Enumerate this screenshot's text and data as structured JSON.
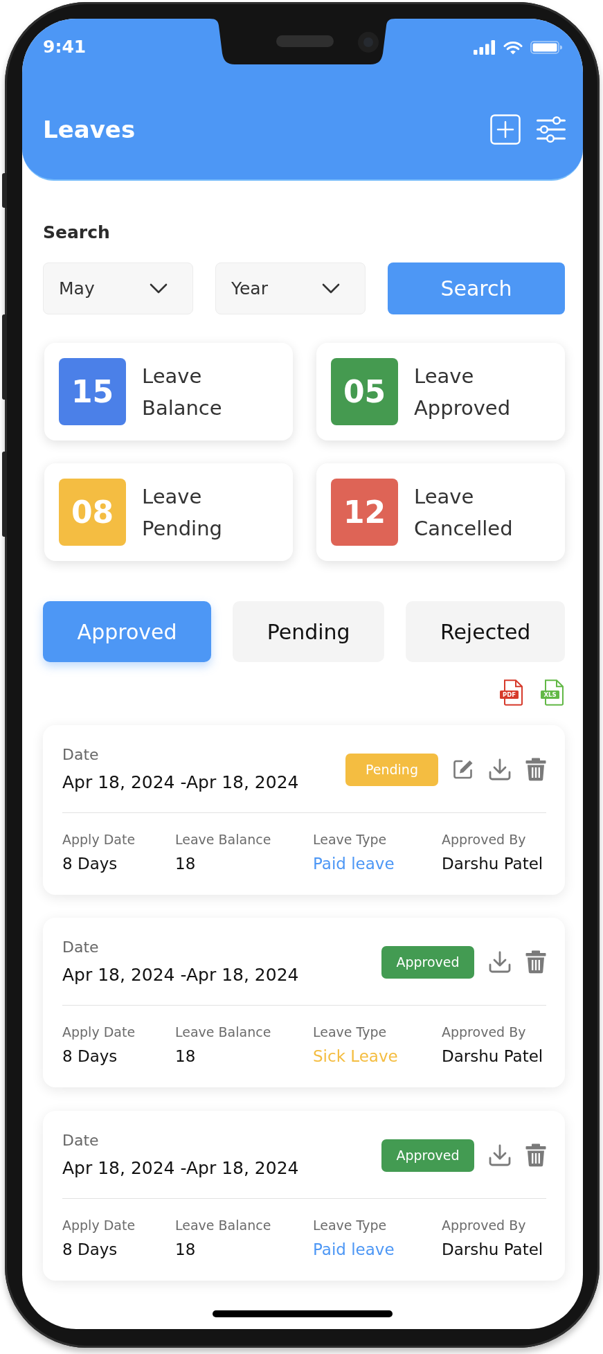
{
  "status_bar": {
    "time": "9:41"
  },
  "header": {
    "title": "Leaves"
  },
  "search": {
    "heading": "Search",
    "dropdowns": [
      {
        "value": "May"
      },
      {
        "value": "Year"
      }
    ],
    "button": "Search"
  },
  "stats": [
    {
      "count": "15",
      "label": "Leave Balance",
      "color": "#4b80e8"
    },
    {
      "count": "05",
      "label": "Leave Approved",
      "color": "#459a50"
    },
    {
      "count": "08",
      "label": "Leave Pending",
      "color": "#f4bd42"
    },
    {
      "count": "12",
      "label": "Leave Cancelled",
      "color": "#de6456"
    }
  ],
  "tabs": [
    {
      "label": "Approved",
      "selected": true
    },
    {
      "label": "Pending",
      "selected": false
    },
    {
      "label": "Rejected",
      "selected": false
    }
  ],
  "exports": [
    {
      "kind": "pdf",
      "label": "PDF"
    },
    {
      "kind": "xls",
      "label": "XLS"
    }
  ],
  "leaves": [
    {
      "date_label": "Date",
      "date_range": "Apr 18, 2024 -Apr 18, 2024",
      "status": {
        "label": "Pending",
        "color": "#f4bd41"
      },
      "editable": true,
      "fields": [
        {
          "label": "Apply Date",
          "value": "8 Days"
        },
        {
          "label": "Leave Balance",
          "value": "18"
        },
        {
          "label": "Leave Type",
          "value": "Paid leave",
          "color": "#4d97f5"
        },
        {
          "label": "Approved By",
          "value": "Darshu Patel"
        }
      ]
    },
    {
      "date_label": "Date",
      "date_range": "Apr 18, 2024 -Apr 18, 2024",
      "status": {
        "label": "Approved",
        "color": "#439b52"
      },
      "editable": false,
      "fields": [
        {
          "label": "Apply Date",
          "value": "8 Days"
        },
        {
          "label": "Leave Balance",
          "value": "18"
        },
        {
          "label": "Leave Type",
          "value": "Sick Leave",
          "color": "#f4bd41"
        },
        {
          "label": "Approved By",
          "value": "Darshu Patel"
        }
      ]
    },
    {
      "date_label": "Date",
      "date_range": "Apr 18, 2024 -Apr 18, 2024",
      "status": {
        "label": "Approved",
        "color": "#439b52"
      },
      "editable": false,
      "fields": [
        {
          "label": "Apply Date",
          "value": "8 Days"
        },
        {
          "label": "Leave Balance",
          "value": "18"
        },
        {
          "label": "Leave Type",
          "value": "Paid leave",
          "color": "#4d97f5"
        },
        {
          "label": "Approved By",
          "value": "Darshu Patel"
        }
      ]
    }
  ]
}
